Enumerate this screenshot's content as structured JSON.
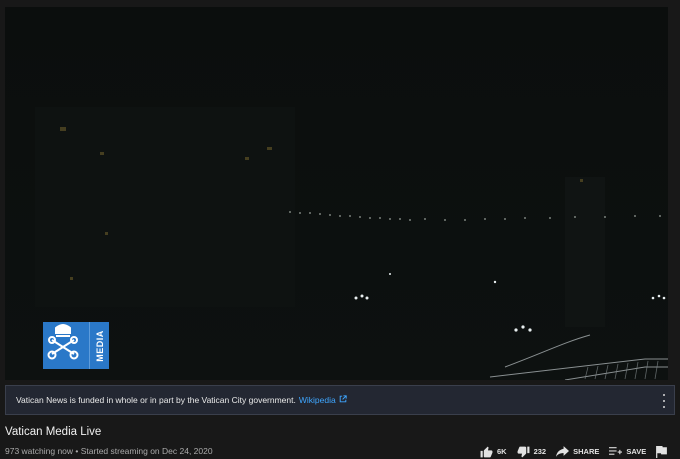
{
  "player": {
    "overlay_logo": {
      "word": "MEDIA",
      "brand_color": "#2a78c8"
    }
  },
  "info_panel": {
    "text": "Vatican News is funded in whole or in part by the Vatican City government.",
    "link_label": "Wikipedia",
    "link_icon": "external-link-icon",
    "menu_icon": "more-vertical-icon"
  },
  "video": {
    "title": "Vatican Media Live",
    "meta": "973 watching now • Started streaming on Dec 24, 2020"
  },
  "actions": {
    "like_count": "6K",
    "dislike_count": "232",
    "share_label": "SHARE",
    "save_label": "SAVE"
  },
  "colors": {
    "background": "#181818",
    "panel_background": "#232732",
    "link": "#3ea6ff",
    "secondary_text": "#aaaaaa"
  }
}
